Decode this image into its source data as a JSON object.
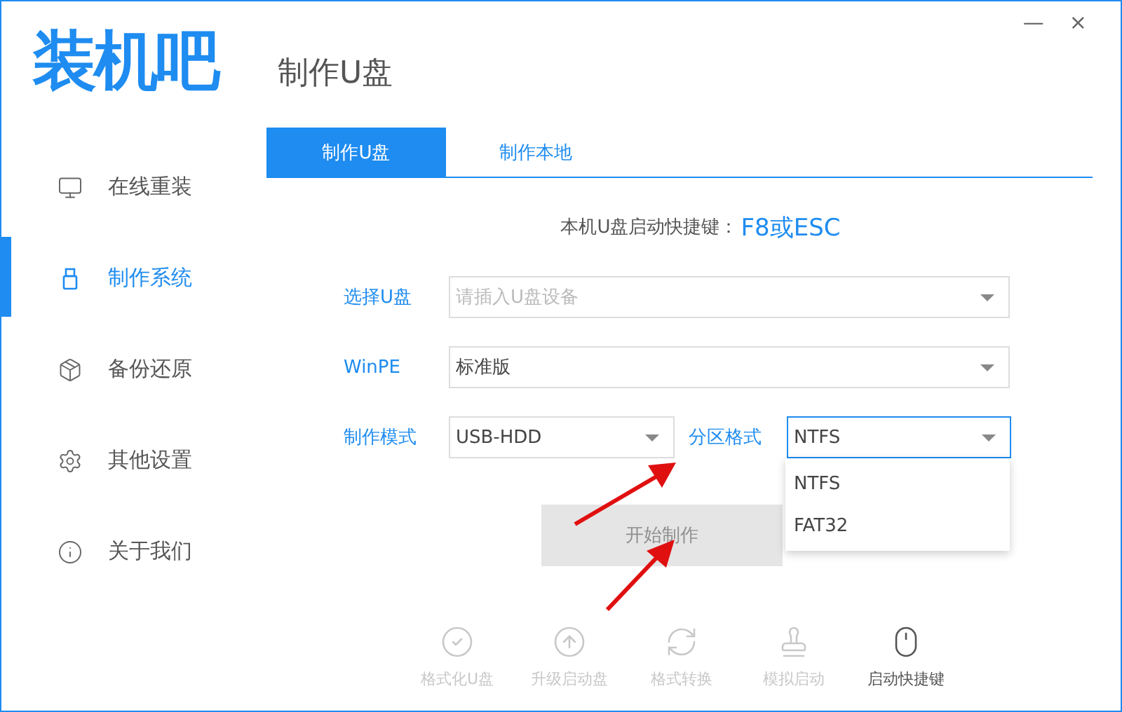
{
  "logo": "装机吧",
  "window_controls": {
    "minimize": "—",
    "close": "×"
  },
  "sidebar": {
    "items": [
      {
        "label": "在线重装",
        "selected": false
      },
      {
        "label": "制作系统",
        "selected": true
      },
      {
        "label": "备份还原",
        "selected": false
      },
      {
        "label": "其他设置",
        "selected": false
      },
      {
        "label": "关于我们",
        "selected": false
      }
    ]
  },
  "page_title": "制作U盘",
  "tabs": [
    {
      "label": "制作U盘",
      "selected": true
    },
    {
      "label": "制作本地",
      "selected": false
    }
  ],
  "hotkey": {
    "label": "本机U盘启动快捷键：",
    "value": "F8或ESC"
  },
  "form": {
    "usb_drive": {
      "label": "选择U盘",
      "placeholder": "请插入U盘设备"
    },
    "winpe": {
      "label": "WinPE",
      "value": "标准版"
    },
    "mode": {
      "label": "制作模式",
      "value": "USB-HDD"
    },
    "partition": {
      "label": "分区格式",
      "value": "NTFS",
      "expanded": true,
      "options": [
        "NTFS",
        "FAT32"
      ]
    }
  },
  "start_button": {
    "label": "开始制作",
    "disabled": true
  },
  "tools": [
    {
      "label": "格式化U盘",
      "disabled": true
    },
    {
      "label": "升级启动盘",
      "disabled": true
    },
    {
      "label": "格式转换",
      "disabled": true
    },
    {
      "label": "模拟启动",
      "disabled": true
    },
    {
      "label": "启动快捷键",
      "disabled": false
    }
  ]
}
